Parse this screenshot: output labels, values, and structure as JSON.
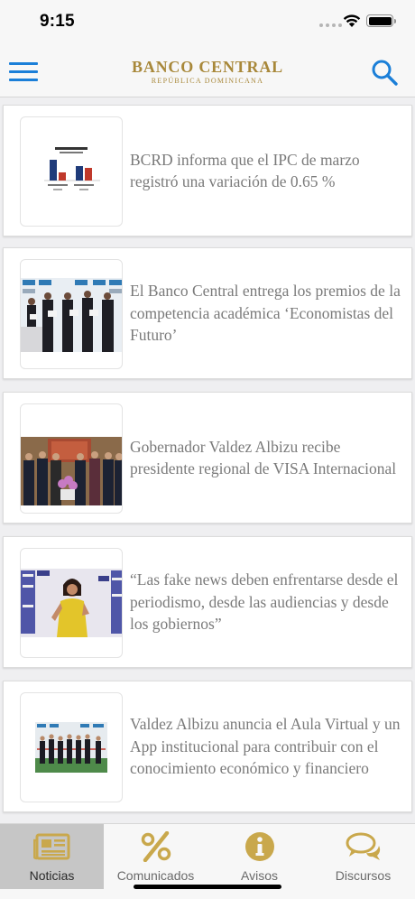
{
  "status_bar": {
    "time": "9:15"
  },
  "header": {
    "brand_name": "BANCO CENTRAL",
    "brand_subtitle": "REPÚBLICA DOMINICANA"
  },
  "news": [
    {
      "title": "BCRD informa que el IPC de marzo registró una variación de 0.65 %",
      "thumbnail": "bar-chart-thumbnail"
    },
    {
      "title": "El Banco Central entrega los premios de la competencia académica ‘Economistas del Futuro’",
      "thumbnail": "award-ceremony-photo"
    },
    {
      "title": "Gobernador Valdez Albizu recibe presidente regional de VISA Internacional",
      "thumbnail": "group-meeting-photo"
    },
    {
      "title": "“Las fake news deben enfrentarse desde el periodismo, desde las audiencias y desde los gobiernos”",
      "thumbnail": "speaker-photo"
    },
    {
      "title": "Valdez Albizu anuncia el Aula Virtual y un App institucional para contribuir con el conocimiento económico y financiero",
      "thumbnail": "ribbon-cutting-photo"
    }
  ],
  "tabs": [
    {
      "label": "Noticias",
      "icon": "newspaper-icon",
      "active": true
    },
    {
      "label": "Comunicados",
      "icon": "percent-icon",
      "active": false
    },
    {
      "label": "Avisos",
      "icon": "info-icon",
      "active": false
    },
    {
      "label": "Discursos",
      "icon": "speech-bubbles-icon",
      "active": false
    }
  ],
  "colors": {
    "brand_gold": "#a8883a",
    "accent_blue": "#1b7fd8",
    "tab_icon_gold": "#c9a84c"
  }
}
